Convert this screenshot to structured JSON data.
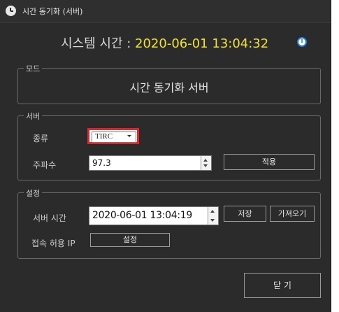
{
  "window": {
    "title": "시간 동기화 (서버)"
  },
  "header": {
    "system_time_label": "시스템 시간 : ",
    "system_time_value": "2020-06-01 13:04:32"
  },
  "mode_group": {
    "legend": "모드",
    "mode_text": "시간 동기화 서버"
  },
  "server_group": {
    "legend": "서버",
    "type_label": "종류",
    "type_value": "TIRC",
    "frequency_label": "주파수",
    "frequency_value": "97.3",
    "apply_button": "적용"
  },
  "settings_group": {
    "legend": "설정",
    "server_time_label": "서버 시간",
    "server_time_value": "2020-06-01 13:04:19",
    "save_button": "저장",
    "load_button": "가져오기",
    "allowed_ip_label": "접속 허용 IP",
    "set_button": "설정"
  },
  "footer": {
    "close_button": "닫 기"
  },
  "colors": {
    "background": "#2b2b2b",
    "time_value": "#f0e23a",
    "highlight_border": "#e0262a",
    "info_blue": "#1f7de0"
  }
}
